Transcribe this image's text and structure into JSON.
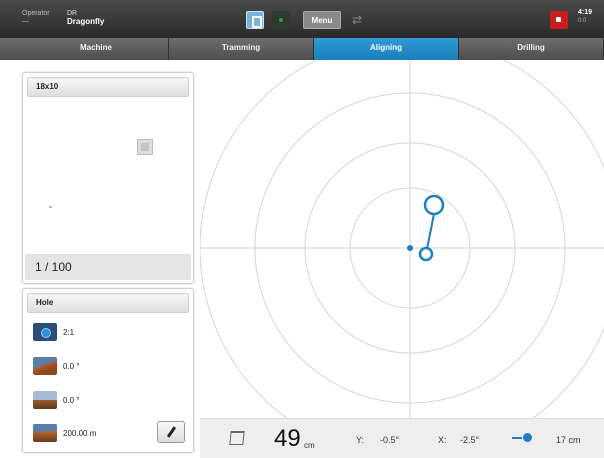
{
  "topbar": {
    "operator_label": "Operator",
    "operator_value": "—",
    "drill_label": "DR",
    "drill_name": "Dragonfly",
    "menu_label": "Menu",
    "time": "4:19",
    "time_sub": "0:0"
  },
  "tabs": [
    {
      "label": "Machine",
      "active": false
    },
    {
      "label": "Tramming",
      "active": false
    },
    {
      "label": "Aligning",
      "active": true
    },
    {
      "label": "Drilling",
      "active": false
    }
  ],
  "pattern_panel": {
    "title": "18x10",
    "counter": "1 / 100"
  },
  "hole_panel": {
    "title": "Hole",
    "scale": "2:1",
    "dip": "0.0 °",
    "azimuth": "0.0 °",
    "length": "200.00 m"
  },
  "bottom": {
    "depth_value": "49",
    "depth_unit": "cm",
    "y_label": "Y:",
    "y_value": "-0.5°",
    "x_label": "X:",
    "x_value": "-2.5°",
    "distance": "17 cm"
  },
  "colors": {
    "accent": "#1e7fc0",
    "tab_active": "#2390cf",
    "alert": "#c81e1e"
  },
  "target": {
    "ring_count": 4,
    "current_position": {
      "x_deg": -2.5,
      "y_deg": -0.5
    }
  }
}
